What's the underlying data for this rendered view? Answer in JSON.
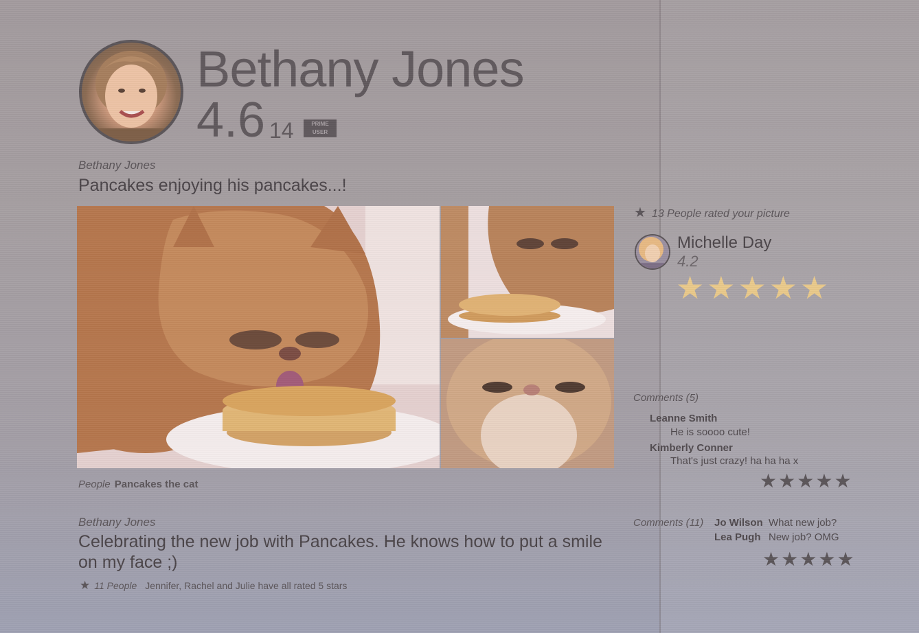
{
  "profile": {
    "name": "Bethany Jones",
    "rating": "4.6",
    "rating_count": "14",
    "badge_line1": "PRIME",
    "badge_line2": "USER"
  },
  "posts": [
    {
      "author": "Bethany Jones",
      "text": "Pancakes enjoying his pancakes...!",
      "people_label": "People",
      "people_value": "Pancakes the cat"
    },
    {
      "author": "Bethany Jones",
      "text": "Celebrating the new job with Pancakes. He knows how to put a smile on my face ;)",
      "stats_count": "11 People",
      "stats_text": "Jennifer, Rachel and Julie have all rated 5 stars"
    }
  ],
  "rating_panel": {
    "summary": "13 People rated your picture",
    "rater_name": "Michelle Day",
    "rater_score": "4.2",
    "rater_stars": 5
  },
  "comments1": {
    "header": "Comments (5)",
    "items": [
      {
        "name": "Leanne Smith",
        "text": "He is soooo cute!"
      },
      {
        "name": "Kimberly Conner",
        "text": "That's just crazy! ha ha ha x"
      }
    ],
    "stars": 5
  },
  "comments2": {
    "header": "Comments (11)",
    "items": [
      {
        "name": "Jo Wilson",
        "text": "What new job?"
      },
      {
        "name": "Lea Pugh",
        "text": "New job? OMG"
      }
    ],
    "stars": 5
  },
  "colors": {
    "gold_star": "#e9c98a",
    "dark_star": "#5a5458",
    "text": "#4a4448"
  }
}
